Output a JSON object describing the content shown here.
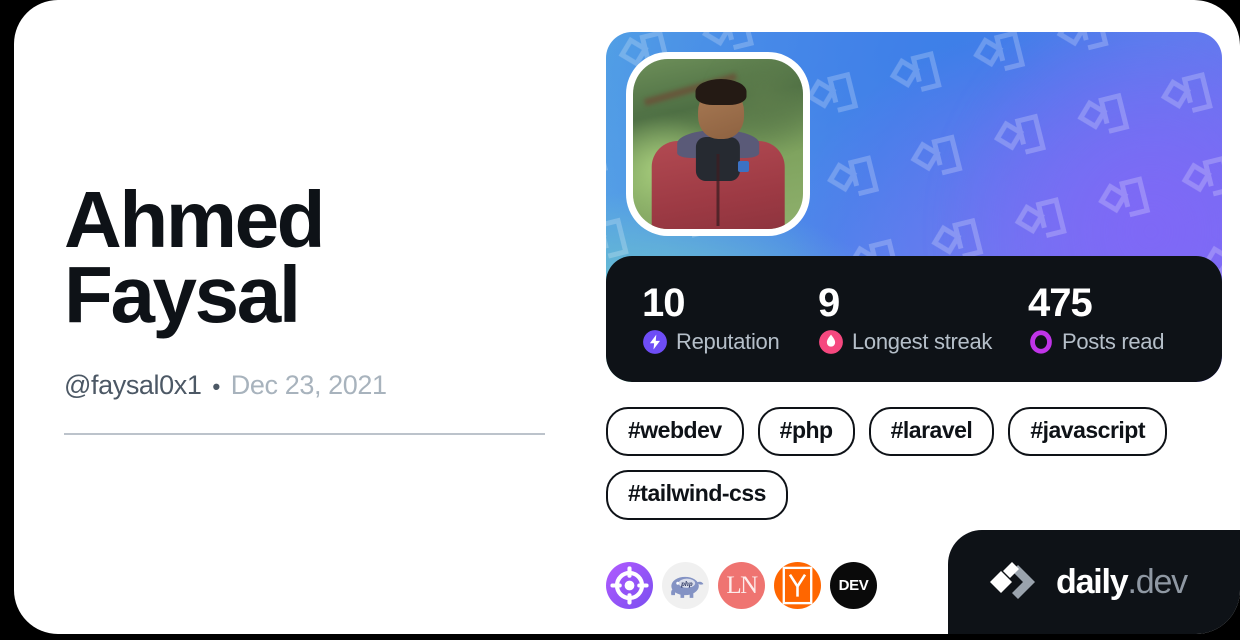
{
  "profile": {
    "name": "Ahmed Faysal",
    "name_line1": "Ahmed",
    "name_line2": "Faysal",
    "handle": "@faysal0x1",
    "separator": "•",
    "joined_date": "Dec 23, 2021",
    "avatar_alt": "profile-photo"
  },
  "stats": [
    {
      "value": "10",
      "label": "Reputation",
      "icon": "reputation-bolt-icon",
      "color": "#6e4df6"
    },
    {
      "value": "9",
      "label": "Longest streak",
      "icon": "streak-flame-icon",
      "color": "#f5487f"
    },
    {
      "value": "475",
      "label": "Posts read",
      "icon": "posts-read-eye-icon",
      "color": "#c034e8"
    }
  ],
  "tags": [
    {
      "label": "#webdev"
    },
    {
      "label": "#php"
    },
    {
      "label": "#laravel"
    },
    {
      "label": "#javascript"
    },
    {
      "label": "#tailwind-css"
    }
  ],
  "badges": [
    {
      "name": "badge-dailydev",
      "title": "daily.dev",
      "text": ""
    },
    {
      "name": "badge-php",
      "title": "PHP",
      "text": ""
    },
    {
      "name": "badge-ln",
      "title": "LogRocket",
      "text": "LN"
    },
    {
      "name": "badge-hn",
      "title": "Hacker News",
      "text": "Y"
    },
    {
      "name": "badge-dev",
      "title": "DEV Community",
      "text": "DEV"
    }
  ],
  "watermark": {
    "brand": "daily",
    "suffix": ".dev"
  },
  "theme": {
    "page_background": "#000000",
    "card_background": "#ffffff",
    "stats_background": "#0e1217",
    "text_primary": "#0e1217",
    "text_handle": "#4c5865",
    "text_muted": "#a8b3bd",
    "divider": "#bcc3cb"
  }
}
